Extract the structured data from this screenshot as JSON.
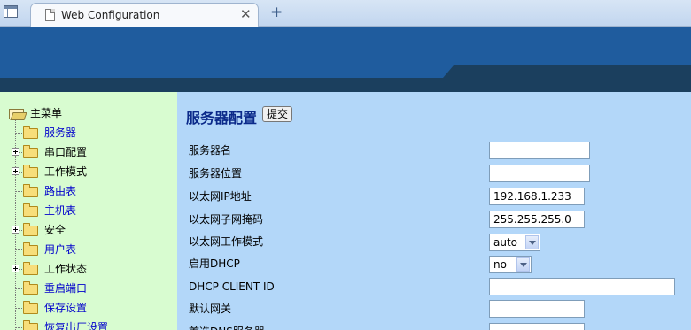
{
  "browser": {
    "tab_title": "Web Configuration",
    "close_glyph": "✕",
    "new_tab_glyph": "+"
  },
  "sidebar": {
    "root_label": "主菜单",
    "items": [
      {
        "label": "服务器",
        "kind": "link",
        "expandable": false
      },
      {
        "label": "串口配置",
        "kind": "group",
        "expandable": true
      },
      {
        "label": "工作模式",
        "kind": "group",
        "expandable": true
      },
      {
        "label": "路由表",
        "kind": "link",
        "expandable": false
      },
      {
        "label": "主机表",
        "kind": "link",
        "expandable": false
      },
      {
        "label": "安全",
        "kind": "group",
        "expandable": true
      },
      {
        "label": "用户表",
        "kind": "link",
        "expandable": false
      },
      {
        "label": "工作状态",
        "kind": "group",
        "expandable": true
      },
      {
        "label": "重启端口",
        "kind": "link",
        "expandable": false
      },
      {
        "label": "保存设置",
        "kind": "link",
        "expandable": false
      },
      {
        "label": "恢复出厂设置",
        "kind": "link",
        "expandable": false
      }
    ]
  },
  "main": {
    "title": "服务器配置",
    "submit_label": "提交",
    "fields": [
      {
        "label": "服务器名",
        "type": "text",
        "value": ""
      },
      {
        "label": "服务器位置",
        "type": "text",
        "value": ""
      },
      {
        "label": "以太网IP地址",
        "type": "text",
        "value": "192.168.1.233"
      },
      {
        "label": "以太网子网掩码",
        "type": "text",
        "value": "255.255.255.0"
      },
      {
        "label": "以太网工作模式",
        "type": "select",
        "value": "auto"
      },
      {
        "label": "启用DHCP",
        "type": "select",
        "value": "no"
      },
      {
        "label": "DHCP CLIENT ID",
        "type": "text",
        "value": ""
      },
      {
        "label": "默认网关",
        "type": "text",
        "value": ""
      },
      {
        "label": "首选DNS服务器",
        "type": "text",
        "value": ""
      }
    ]
  },
  "colors": {
    "sidebar_bg": "#d8fcd0",
    "main_bg": "#b3d7f9",
    "banner": "#1f5c9e",
    "banner_dark": "#1b3f5e",
    "title": "#0b2a8a",
    "link": "#0000cc"
  }
}
